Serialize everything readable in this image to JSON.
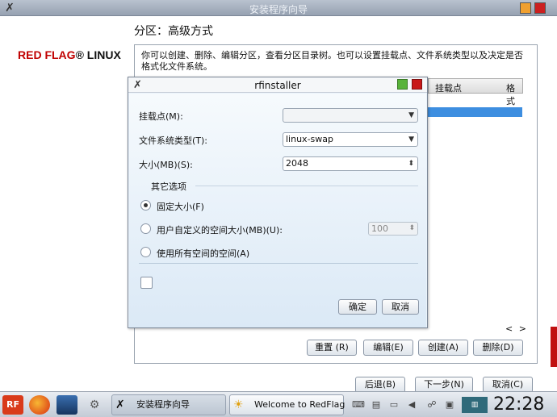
{
  "window": {
    "title": "安装程序向导"
  },
  "brand": {
    "red": "RED FLAG",
    "reg": "®",
    "black": " LINUX"
  },
  "page": {
    "title": "分区：高级方式",
    "intro": "你可以创建、删除、编辑分区，查看分区目录树。也可以设置挂载点、文件系统类型以及决定是否格式化文件系统。"
  },
  "table": {
    "columns": [
      "挂载点",
      "格式"
    ]
  },
  "scroll_arrows": "< >",
  "buttons": {
    "reset": "重置 (R)",
    "edit": "编辑(E)",
    "create": "创建(A)",
    "delete": "删除(D)",
    "back": "后退(B)",
    "next": "下一步(N)",
    "cancel": "取消(C)"
  },
  "dialog": {
    "title": "rfinstaller",
    "mount_label": "挂载点(M):",
    "mount_value": "",
    "fstype_label": "文件系统类型(T):",
    "fstype_value": "linux-swap",
    "size_label": "大小(MB)(S):",
    "size_value": "2048",
    "group_label": "其它选项",
    "options": [
      {
        "label": "固定大小(F)",
        "checked": true
      },
      {
        "label": "用户自定义的空间大小(MB)(U):",
        "checked": false
      },
      {
        "label": "使用所有空间的空间(A)",
        "checked": false
      }
    ],
    "custom_size_value": "100",
    "encrypt_checked": false,
    "ok": "确定",
    "cancel": "取消"
  },
  "taskbar": {
    "start_label": "RF",
    "tasks": [
      {
        "label": "安装程序向导",
        "active": true
      },
      {
        "label": "Welcome to RedFlag",
        "active": false
      }
    ],
    "clock": "22:28"
  }
}
